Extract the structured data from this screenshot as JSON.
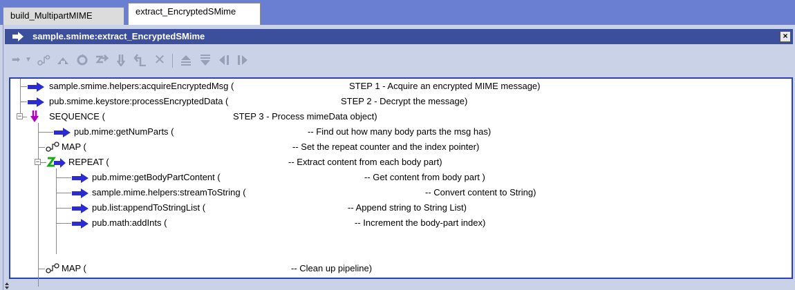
{
  "tabs": [
    {
      "label": "build_MultipartMIME"
    },
    {
      "label": "extract_EncryptedSMime"
    }
  ],
  "panel": {
    "title": "sample.smime:extract_EncryptedSMime",
    "close_label": "×"
  },
  "toolbar": {
    "icons": [
      "insert-icon",
      "dropdown-icon",
      "map-icon",
      "branch-icon",
      "loop-icon",
      "repeat-icon",
      "sequence-icon",
      "exit-icon",
      "delete-icon",
      "move-up-icon",
      "move-down-icon",
      "indent-left-icon",
      "indent-right-icon"
    ]
  },
  "tree": {
    "rows": [
      {
        "label": "sample.smime.helpers:acquireEncryptedMsg (",
        "comment": "STEP 1 - Acquire an encrypted MIME message)"
      },
      {
        "label": "pub.smime.keystore:processEncryptedData (",
        "comment": "STEP 2 - Decrypt the message)"
      },
      {
        "label": "SEQUENCE (",
        "comment": "STEP 3 - Process mimeData object)"
      },
      {
        "label": "pub.mime:getNumParts (",
        "comment": "-- Find out how many body parts the msg has)"
      },
      {
        "label": "MAP (",
        "comment": "-- Set the repeat counter and the index pointer)"
      },
      {
        "label": "REPEAT (",
        "comment": "-- Extract content from each body part)"
      },
      {
        "label": "pub.mime:getBodyPartContent (",
        "comment": "-- Get content from body part )"
      },
      {
        "label": "sample.mime.helpers:streamToString (",
        "comment": "-- Convert content to String)"
      },
      {
        "label": "pub.list:appendToStringList (",
        "comment": "-- Append string to String List)"
      },
      {
        "label": "pub.math:addInts (",
        "comment": "-- Increment the body-part index)"
      },
      {
        "label": "MAP (",
        "comment": "-- Clean up pipeline)"
      }
    ]
  },
  "colors": {
    "invoke_arrow": "#2b2bd6",
    "sequence": "#b000c0",
    "repeat": "#1aa81a",
    "title_bg": "#3b4f9c"
  }
}
